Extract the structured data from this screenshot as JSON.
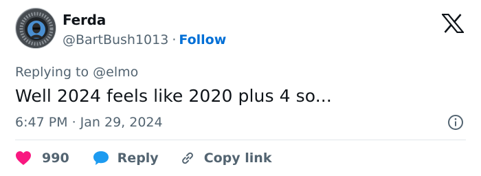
{
  "author": {
    "name": "Ferda",
    "handle": "@BartBush1013",
    "separator": "·",
    "follow_label": "Follow",
    "avatar_icon": "profile-avatar"
  },
  "brand": {
    "logo_icon": "x-logo-icon",
    "color": "#0f1419"
  },
  "tweet": {
    "replying_to": "Replying to @elmo",
    "text": "Well 2024 feels like 2020 plus 4 so...",
    "timestamp": "6:47 PM · Jan 29, 2024"
  },
  "actions": {
    "like_count": "990",
    "reply_label": "Reply",
    "copy_label": "Copy link"
  },
  "colors": {
    "like": "#f91880",
    "reply": "#1d9bf0",
    "link": "#006fd6",
    "muted": "#536471"
  }
}
